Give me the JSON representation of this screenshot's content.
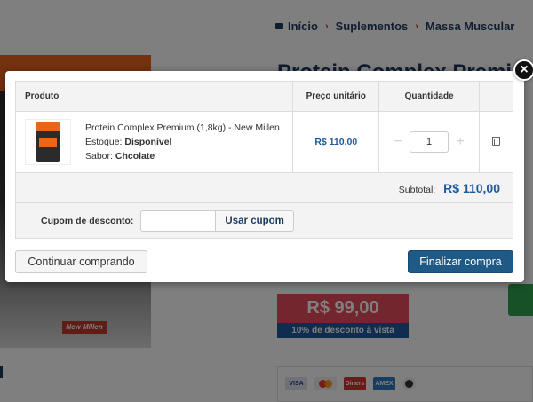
{
  "breadcrumb": {
    "items": [
      "Início",
      "Suplementos",
      "Massa Muscular"
    ],
    "separator": "›"
  },
  "background": {
    "product_title": "Protein Complex Premium",
    "price": "R$ 99,00",
    "discount_note": "10% de desconto à vista",
    "package_label": "New Millen",
    "payment_methods": [
      {
        "icon": "visa-icon",
        "label": "VISA"
      },
      {
        "icon": "mastercard-icon",
        "label": ""
      },
      {
        "icon": "diners-icon",
        "label": "Diners"
      },
      {
        "icon": "amex-icon",
        "label": "AMEX"
      },
      {
        "icon": "other-card-icon",
        "label": ""
      }
    ]
  },
  "modal": {
    "close_label": "×",
    "table": {
      "headers": {
        "product": "Produto",
        "unit_price": "Preço unitário",
        "quantity": "Quantidade"
      },
      "item": {
        "name": "Protein Complex Premium (1,8kg) - New Millen",
        "stock_label": "Estoque:",
        "stock_value": "Disponível",
        "flavor_label": "Sabor:",
        "flavor_value": "Chcolate",
        "unit_price": "R$ 110,00",
        "quantity": "1",
        "qty_minus": "−",
        "qty_plus": "+"
      },
      "subtotal_label": "Subtotal:",
      "subtotal_value": "R$ 110,00"
    },
    "coupon": {
      "label": "Cupom de desconto:",
      "value": "",
      "button": "Usar cupom"
    },
    "continue_button": "Continuar comprando",
    "finish_button": "Finalizar compra"
  },
  "colors": {
    "primary": "#1f5a86",
    "link_blue": "#1f5a9c",
    "breadcrumb": "#1f3a5f",
    "accent_red": "#c0392b",
    "price_red": "#e74c5a"
  }
}
